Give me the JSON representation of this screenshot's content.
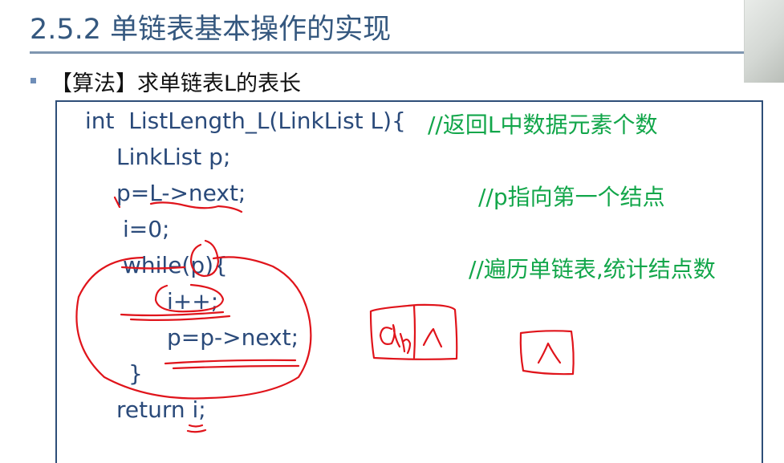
{
  "slide": {
    "title": "2.5.2 单链表基本操作的实现",
    "bullet": "【算法】求单链表L的表长"
  },
  "code": {
    "lines": [
      "int  ListLength_L(LinkList L){",
      "LinkList p;",
      "p=L->next;",
      "i=0;",
      "while(p){",
      "i++;",
      "p=p->next;",
      "}",
      "return i;"
    ],
    "comments": [
      "//返回L中数据元素个数",
      "//p指向第一个结点",
      "//遍历单链表,统计结点数"
    ]
  },
  "annotations": {
    "node_label": "a",
    "node_subscript": "n",
    "null_symbol": "^"
  },
  "colors": {
    "title": "#35587f",
    "code": "#2a4a7a",
    "comment": "#12a64a",
    "ink": "#e0141b"
  }
}
